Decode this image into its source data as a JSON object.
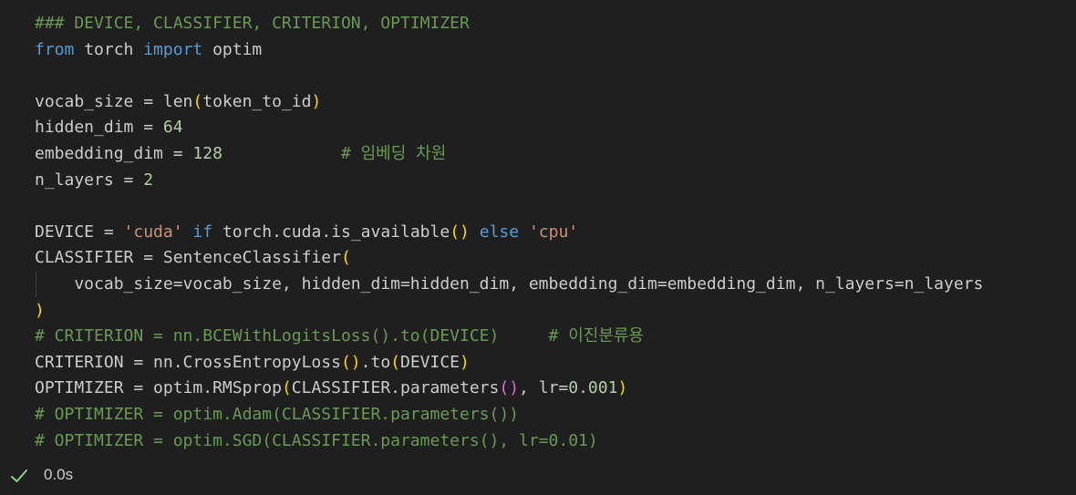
{
  "colors": {
    "background": "#1f1f1f",
    "default": "#cccccc",
    "comment": "#6a9955",
    "keyword": "#569cd6",
    "control": "#c586c0",
    "string": "#ce9178",
    "number": "#b5cea8",
    "bracket_gold": "#ffd700",
    "bracket_purple": "#da70d6",
    "status_check": "#89d185"
  },
  "cell": {
    "lines": [
      {
        "tokens": [
          {
            "t": "### DEVICE, CLASSIFIER, CRITERION, OPTIMIZER",
            "c": "comment"
          }
        ]
      },
      {
        "tokens": [
          {
            "t": "from",
            "c": "keyword"
          },
          {
            "t": " torch ",
            "c": "default"
          },
          {
            "t": "import",
            "c": "keyword"
          },
          {
            "t": " optim",
            "c": "default"
          }
        ]
      },
      {
        "tokens": []
      },
      {
        "tokens": [
          {
            "t": "vocab_size = len",
            "c": "default"
          },
          {
            "t": "(",
            "c": "bracket_gold"
          },
          {
            "t": "token_to_id",
            "c": "default"
          },
          {
            "t": ")",
            "c": "bracket_gold"
          }
        ]
      },
      {
        "tokens": [
          {
            "t": "hidden_dim = ",
            "c": "default"
          },
          {
            "t": "64",
            "c": "number"
          }
        ]
      },
      {
        "tokens": [
          {
            "t": "embedding_dim = ",
            "c": "default"
          },
          {
            "t": "128",
            "c": "number"
          },
          {
            "t": "            ",
            "c": "default"
          },
          {
            "t": "# 임베딩 차원",
            "c": "comment"
          }
        ]
      },
      {
        "tokens": [
          {
            "t": "n_layers = ",
            "c": "default"
          },
          {
            "t": "2",
            "c": "number"
          }
        ]
      },
      {
        "tokens": []
      },
      {
        "tokens": [
          {
            "t": "DEVICE = ",
            "c": "default"
          },
          {
            "t": "'cuda'",
            "c": "string"
          },
          {
            "t": " ",
            "c": "default"
          },
          {
            "t": "if",
            "c": "keyword"
          },
          {
            "t": " torch.cuda.is_available",
            "c": "default"
          },
          {
            "t": "()",
            "c": "bracket_gold"
          },
          {
            "t": " ",
            "c": "default"
          },
          {
            "t": "else",
            "c": "keyword"
          },
          {
            "t": " ",
            "c": "default"
          },
          {
            "t": "'cpu'",
            "c": "string"
          }
        ]
      },
      {
        "tokens": [
          {
            "t": "CLASSIFIER = SentenceClassifier",
            "c": "default"
          },
          {
            "t": "(",
            "c": "bracket_gold"
          }
        ]
      },
      {
        "tokens": [
          {
            "t": "    vocab_size=vocab_size, hidden_dim=hidden_dim, embedding_dim=embedding_dim, n_layers=n_layers",
            "c": "default"
          }
        ]
      },
      {
        "tokens": [
          {
            "t": ")",
            "c": "bracket_gold"
          }
        ]
      },
      {
        "tokens": [
          {
            "t": "# CRITERION = nn.BCEWithLogitsLoss().to(DEVICE)     # 이진분류용",
            "c": "comment"
          }
        ]
      },
      {
        "tokens": [
          {
            "t": "CRITERION = nn.CrossEntropyLoss",
            "c": "default"
          },
          {
            "t": "()",
            "c": "bracket_gold"
          },
          {
            "t": ".to",
            "c": "default"
          },
          {
            "t": "(",
            "c": "bracket_gold"
          },
          {
            "t": "DEVICE",
            "c": "default"
          },
          {
            "t": ")",
            "c": "bracket_gold"
          }
        ]
      },
      {
        "tokens": [
          {
            "t": "OPTIMIZER = optim.RMSprop",
            "c": "default"
          },
          {
            "t": "(",
            "c": "bracket_gold"
          },
          {
            "t": "CLASSIFIER.parameters",
            "c": "default"
          },
          {
            "t": "()",
            "c": "bracket_purple"
          },
          {
            "t": ", lr=",
            "c": "default"
          },
          {
            "t": "0.001",
            "c": "number"
          },
          {
            "t": ")",
            "c": "bracket_gold"
          }
        ]
      },
      {
        "tokens": [
          {
            "t": "# OPTIMIZER = optim.Adam(CLASSIFIER.parameters())",
            "c": "comment"
          }
        ]
      },
      {
        "tokens": [
          {
            "t": "# OPTIMIZER = optim.SGD(CLASSIFIER.parameters(), lr=0.01)",
            "c": "comment"
          }
        ]
      }
    ]
  },
  "status": {
    "icon": "check-icon",
    "duration": "0.0s"
  }
}
